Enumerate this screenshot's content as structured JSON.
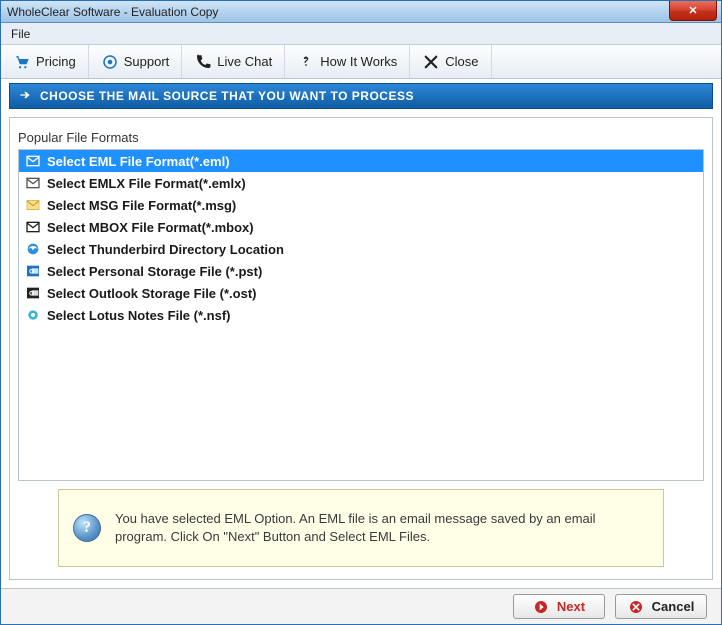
{
  "titlebar": {
    "title": "WholeClear Software - Evaluation Copy"
  },
  "menubar": {
    "file": "File"
  },
  "toolbar": {
    "pricing": "Pricing",
    "support": "Support",
    "livechat": "Live Chat",
    "howitworks": "How It Works",
    "close": "Close"
  },
  "heading": "CHOOSE THE MAIL SOURCE THAT YOU WANT TO PROCESS",
  "group": {
    "label": "Popular File Formats"
  },
  "formats": [
    {
      "label": "Select EML File Format(*.eml)",
      "icon": "eml",
      "selected": true
    },
    {
      "label": "Select EMLX File Format(*.emlx)",
      "icon": "emlx",
      "selected": false
    },
    {
      "label": "Select MSG File Format(*.msg)",
      "icon": "msg",
      "selected": false
    },
    {
      "label": "Select MBOX File Format(*.mbox)",
      "icon": "mbox",
      "selected": false
    },
    {
      "label": "Select Thunderbird Directory Location",
      "icon": "thunderbird",
      "selected": false
    },
    {
      "label": "Select Personal Storage File (*.pst)",
      "icon": "pst",
      "selected": false
    },
    {
      "label": "Select Outlook Storage File (*.ost)",
      "icon": "ost",
      "selected": false
    },
    {
      "label": "Select Lotus Notes File (*.nsf)",
      "icon": "nsf",
      "selected": false
    }
  ],
  "info": {
    "text": "You have selected EML Option. An EML file is an email message saved by an email program. Click On \"Next\" Button and Select EML Files."
  },
  "buttons": {
    "next": "Next",
    "cancel": "Cancel"
  }
}
